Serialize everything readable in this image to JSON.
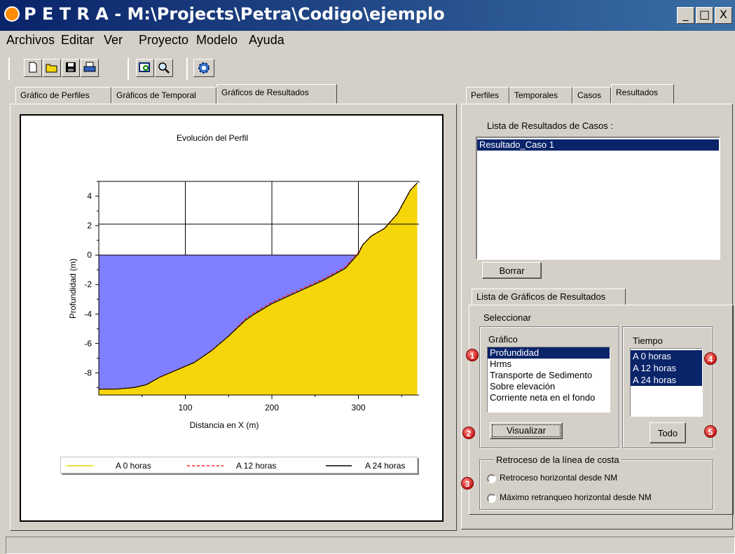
{
  "window": {
    "title": "P E T R A - M:\\Projects\\Petra\\Codigo\\ejemplo",
    "controls": [
      "_",
      "□",
      "X"
    ]
  },
  "menu": [
    "Archivos",
    "Editar",
    "Ver",
    "Proyecto",
    "Modelo",
    "Ayuda"
  ],
  "toolbar": {
    "buttons": [
      "new-file-icon",
      "open-folder-icon",
      "save-disk-icon",
      "print-icon",
      "zoom-window-icon",
      "magnifier-icon",
      "gear-icon"
    ]
  },
  "left_tabs": [
    "Gráfico de Perfiles",
    "Gráficos de Temporal",
    "Gráficos de Resultados"
  ],
  "right_tabs": [
    "Perfiles",
    "Temporales",
    "Casos",
    "Resultados"
  ],
  "results": {
    "list_label": "Lista de Resultados de Casos :",
    "items": [
      "Resultado_Caso 1"
    ],
    "delete_button": "Borrar"
  },
  "graphs": {
    "tab_label": "Lista de Gráficos de Resultados",
    "select_label": "Seleccionar",
    "graph_group_label": "Gráfico",
    "graph_items": [
      "Profundidad",
      "Hrms",
      "Transporte de Sedimento",
      "Sobre elevación",
      "Corriente neta en el fondo"
    ],
    "graph_selected": "Profundidad",
    "time_group_label": "Tiempo",
    "time_items": [
      "A 0 horas",
      "A 12 horas",
      "A 24 horas"
    ],
    "visualize_button": "Visualizar",
    "all_button": "Todo"
  },
  "coastline": {
    "group_label": "Retroceso de la línea de costa",
    "options": [
      "Retroceso horizontal desde NM",
      "Máximo retranqueo horizontal desde NM"
    ]
  },
  "badges": [
    "1",
    "2",
    "3",
    "4",
    "5"
  ],
  "colors": {
    "title_bg": "#0a246a",
    "selection": "#0a246a",
    "water": "#7f7fff",
    "sand": "#f5d60b",
    "series_0h": "#f0d000",
    "series_12h": "#ff2020",
    "series_24h": "#000000"
  },
  "chart_data": {
    "type": "area",
    "title": "Evolución del Perfil",
    "xlabel": "Distancia en X (m)",
    "ylabel": "Profundidad (m)",
    "xlim": [
      0,
      370
    ],
    "ylim": [
      -9.5,
      5
    ],
    "xticks": [
      100,
      200,
      300
    ],
    "yticks": [
      4,
      2,
      0,
      -2,
      -4,
      -6,
      -8
    ],
    "grid": true,
    "legend_position": "bottom",
    "water_level": 0,
    "series": [
      {
        "name": "A 0 horas",
        "style": "solid",
        "color": "#f0d000",
        "x": [
          0,
          20,
          40,
          55,
          70,
          90,
          110,
          130,
          150,
          170,
          180,
          200,
          230,
          260,
          285,
          300,
          305,
          315,
          330,
          345,
          360,
          368
        ],
        "y": [
          -9.1,
          -9.1,
          -9.0,
          -8.8,
          -8.3,
          -7.8,
          -7.3,
          -6.5,
          -5.5,
          -4.4,
          -4.0,
          -3.3,
          -2.5,
          -1.7,
          -0.9,
          0.1,
          0.7,
          1.3,
          1.8,
          2.8,
          4.4,
          4.9
        ]
      },
      {
        "name": "A 12 horas",
        "style": "dashed",
        "color": "#ff2020",
        "x": [
          0,
          20,
          40,
          55,
          70,
          90,
          110,
          130,
          150,
          170,
          180,
          200,
          230,
          260,
          285,
          300,
          305,
          315,
          330,
          345,
          360,
          368
        ],
        "y": [
          -9.1,
          -9.1,
          -9.0,
          -8.8,
          -8.3,
          -7.8,
          -7.3,
          -6.5,
          -5.5,
          -4.3,
          -3.9,
          -3.2,
          -2.4,
          -1.6,
          -0.8,
          0.2,
          0.7,
          1.3,
          1.8,
          2.8,
          4.4,
          4.9
        ]
      },
      {
        "name": "A 24 horas",
        "style": "solid",
        "color": "#000000",
        "x": [
          0,
          20,
          40,
          55,
          70,
          90,
          110,
          130,
          150,
          170,
          180,
          200,
          230,
          260,
          285,
          300,
          305,
          315,
          330,
          345,
          360,
          368
        ],
        "y": [
          -9.1,
          -9.1,
          -9.0,
          -8.8,
          -8.3,
          -7.8,
          -7.3,
          -6.5,
          -5.5,
          -4.4,
          -4.0,
          -3.3,
          -2.5,
          -1.7,
          -0.9,
          0.1,
          0.7,
          1.3,
          1.8,
          2.8,
          4.4,
          4.9
        ]
      }
    ]
  }
}
